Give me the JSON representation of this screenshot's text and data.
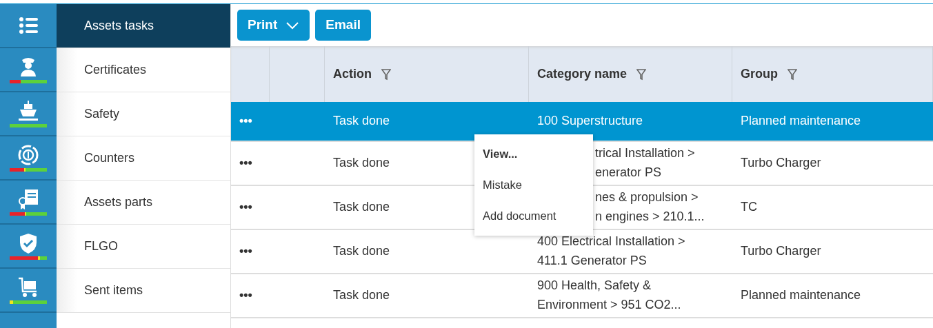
{
  "sidebar": {
    "items": [
      {
        "kind": "list",
        "label": "Assets tasks",
        "selected": true
      },
      {
        "kind": "officer",
        "label": "Certificates",
        "selected": false,
        "status": [
          {
            "color": "#e8232a",
            "level": 0.3
          },
          {
            "color": "#5cd13c",
            "level": 0.7
          }
        ]
      },
      {
        "kind": "ship",
        "label": "Safety",
        "selected": false,
        "status": [
          {
            "color": "#5cd13c",
            "level": 1
          }
        ]
      },
      {
        "kind": "coin",
        "label": "Counters",
        "selected": false,
        "status": [
          {
            "color": "#e8232a",
            "level": 0.38
          },
          {
            "color": "#f2e31b",
            "level": 0.04
          },
          {
            "color": "#5cd13c",
            "level": 0.58
          }
        ]
      },
      {
        "kind": "certificate",
        "label": "Assets parts",
        "selected": false,
        "status": [
          {
            "color": "#e8232a",
            "level": 0.4
          },
          {
            "color": "#f2e31b",
            "level": 0.05
          },
          {
            "color": "#5cd13c",
            "level": 0.55
          }
        ]
      },
      {
        "kind": "shield",
        "label": "FLGO",
        "selected": false,
        "status": [
          {
            "color": "#e8232a",
            "level": 0.76
          },
          {
            "color": "#f2e31b",
            "level": 0.06
          },
          {
            "color": "#5cd13c",
            "level": 0.18
          }
        ]
      },
      {
        "kind": "cart",
        "label": "Sent items",
        "selected": false,
        "status": [
          {
            "color": "#f2e31b",
            "level": 0.1
          },
          {
            "color": "#5cd13c",
            "level": 0.9
          }
        ]
      }
    ]
  },
  "toolbar": {
    "buttons": [
      {
        "label": "Print",
        "dropdown": true
      },
      {
        "label": "Email",
        "dropdown": false
      }
    ]
  },
  "table": {
    "columns": [
      {
        "label": "Action",
        "filter": true
      },
      {
        "label": "Category name",
        "filter": true
      },
      {
        "label": "Group",
        "filter": true
      }
    ],
    "rows": [
      {
        "menu": "•••",
        "action": "Task done",
        "category": [
          "100 Superstructure"
        ],
        "category_covered": false,
        "group": "Planned maintenance",
        "selected": true
      },
      {
        "menu": "•••",
        "action": "Task done",
        "category": [
          "trical Installation >",
          "enerator PS"
        ],
        "category_covered": true,
        "group": "Turbo Charger",
        "selected": false
      },
      {
        "menu": "•••",
        "action": "Task done",
        "category": [
          "nes & propulsion >",
          "n engines > 210.1..."
        ],
        "category_covered": true,
        "group": "TC",
        "selected": false
      },
      {
        "menu": "•••",
        "action": "Task done",
        "category": [
          "400 Electrical Installation >",
          "411.1 Generator PS"
        ],
        "category_covered": false,
        "group": "Turbo Charger",
        "selected": false
      },
      {
        "menu": "•••",
        "action": "Task done",
        "category": [
          "900 Health, Safety &",
          "Environment > 951 CO2..."
        ],
        "category_covered": false,
        "group": "Planned maintenance",
        "selected": false
      }
    ]
  },
  "context_menu": {
    "items": [
      {
        "label": "View...",
        "bold": true
      },
      {
        "label": "Mistake",
        "bold": false
      },
      {
        "label": "Add document",
        "bold": false
      }
    ]
  }
}
